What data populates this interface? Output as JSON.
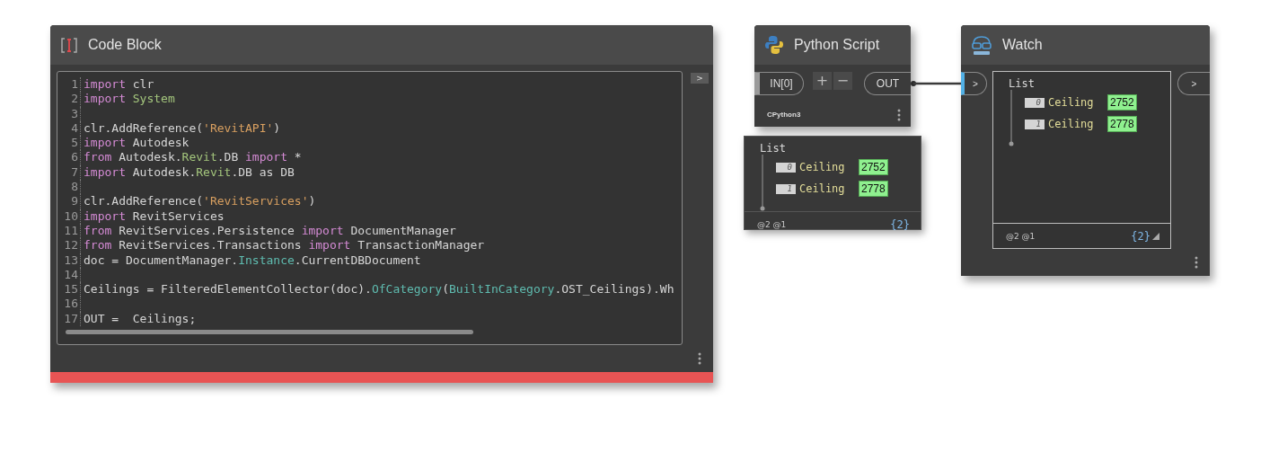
{
  "code_block": {
    "title": "Code Block",
    "error": true,
    "lines": [
      {
        "number": "1",
        "tokens": [
          {
            "text": "import",
            "kind": "keyword"
          },
          {
            "text": " clr",
            "kind": "plain"
          }
        ]
      },
      {
        "number": "2",
        "tokens": [
          {
            "text": "import",
            "kind": "keyword"
          },
          {
            "text": " System",
            "kind": "type"
          }
        ]
      },
      {
        "number": "3"
      },
      {
        "number": "4",
        "tokens": [
          {
            "text": "clr.AddReference(",
            "kind": "plain"
          },
          {
            "text": "'RevitAPI'",
            "kind": "string"
          },
          {
            "text": ")",
            "kind": "plain"
          }
        ]
      },
      {
        "number": "5",
        "tokens": [
          {
            "text": "import",
            "kind": "keyword"
          },
          {
            "text": " Autodesk",
            "kind": "plain"
          }
        ]
      },
      {
        "number": "6",
        "tokens": [
          {
            "text": "from",
            "kind": "keyword"
          },
          {
            "text": " Autodesk.",
            "kind": "plain"
          },
          {
            "text": "Revit",
            "kind": "type"
          },
          {
            "text": ".DB ",
            "kind": "plain"
          },
          {
            "text": "import",
            "kind": "keyword"
          },
          {
            "text": " *",
            "kind": "plain"
          }
        ]
      },
      {
        "number": "7",
        "tokens": [
          {
            "text": "import",
            "kind": "keyword"
          },
          {
            "text": " Autodesk.",
            "kind": "plain"
          },
          {
            "text": "Revit",
            "kind": "type"
          },
          {
            "text": ".DB as DB",
            "kind": "plain"
          }
        ]
      },
      {
        "number": "8"
      },
      {
        "number": "9",
        "tokens": [
          {
            "text": "clr.AddReference(",
            "kind": "plain"
          },
          {
            "text": "'RevitServices'",
            "kind": "string"
          },
          {
            "text": ")",
            "kind": "plain"
          }
        ]
      },
      {
        "number": "10",
        "tokens": [
          {
            "text": "import",
            "kind": "keyword"
          },
          {
            "text": " RevitServices",
            "kind": "plain"
          }
        ]
      },
      {
        "number": "11",
        "tokens": [
          {
            "text": "from",
            "kind": "keyword"
          },
          {
            "text": " RevitServices.Persistence ",
            "kind": "plain"
          },
          {
            "text": "import",
            "kind": "keyword"
          },
          {
            "text": " DocumentManager",
            "kind": "plain"
          }
        ]
      },
      {
        "number": "12",
        "tokens": [
          {
            "text": "from",
            "kind": "keyword"
          },
          {
            "text": " RevitServices.Transactions ",
            "kind": "plain"
          },
          {
            "text": "import",
            "kind": "keyword"
          },
          {
            "text": " TransactionManager",
            "kind": "plain"
          }
        ]
      },
      {
        "number": "13",
        "tokens": [
          {
            "text": "doc = DocumentManager.",
            "kind": "plain"
          },
          {
            "text": "Instance",
            "kind": "member"
          },
          {
            "text": ".CurrentDBDocument",
            "kind": "plain"
          }
        ]
      },
      {
        "number": "14"
      },
      {
        "number": "15",
        "tokens": [
          {
            "text": "Ceilings = FilteredElementCollector(doc).",
            "kind": "plain"
          },
          {
            "text": "OfCategory",
            "kind": "member"
          },
          {
            "text": "(",
            "kind": "plain"
          },
          {
            "text": "BuiltInCategory",
            "kind": "member"
          },
          {
            "text": ".OST_Ceilings).Wh",
            "kind": "plain"
          }
        ]
      },
      {
        "number": "16"
      },
      {
        "number": "17",
        "tokens": [
          {
            "text": "OUT =  Ceilings;",
            "kind": "plain"
          }
        ]
      }
    ],
    "output_port": ">"
  },
  "python_node": {
    "title": "Python Script",
    "input_port": "IN[0]",
    "add_button": "+",
    "remove_button": "−",
    "output_port": "OUT",
    "engine": "CPython3",
    "preview": {
      "root": "List",
      "items": [
        {
          "index": "0",
          "label": "Ceiling",
          "value": "2752"
        },
        {
          "index": "1",
          "label": "Ceiling",
          "value": "2778"
        }
      ],
      "levels": "@2 @1",
      "count": "{2}"
    }
  },
  "watch_node": {
    "title": "Watch",
    "input_port": ">",
    "output_port": ">",
    "preview": {
      "root": "List",
      "items": [
        {
          "index": "0",
          "label": "Ceiling",
          "value": "2752"
        },
        {
          "index": "1",
          "label": "Ceiling",
          "value": "2778"
        }
      ],
      "levels": "@2 @1",
      "count": "{2}"
    }
  }
}
